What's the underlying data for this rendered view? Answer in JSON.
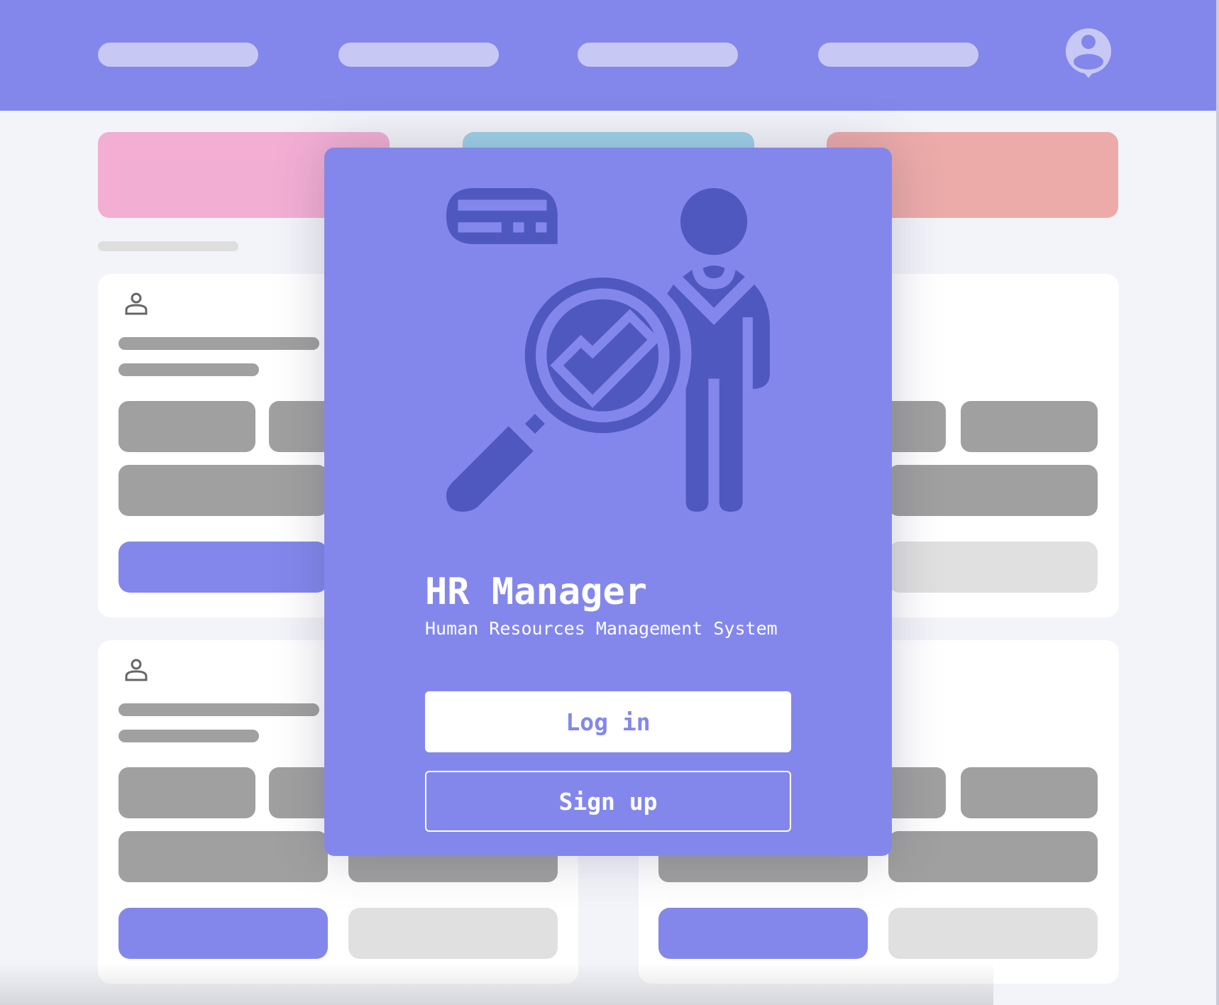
{
  "header": {
    "nav_items": 4,
    "avatar_icon": "user-location-icon"
  },
  "modal": {
    "illustration": "hr-inspector-illustration",
    "title": "HR Manager",
    "subtitle": "Human Resources Management System",
    "login_label": "Log in",
    "signup_label": "Sign up"
  },
  "colors": {
    "accent": "#8387ec",
    "accent_dark": "#4f58bf",
    "pink": "#f3aed4",
    "blue": "#9ed2e8",
    "salmon": "#ecaba9"
  }
}
